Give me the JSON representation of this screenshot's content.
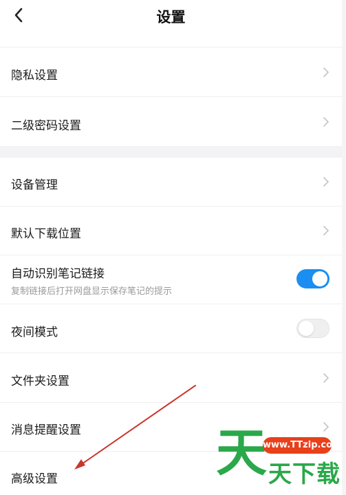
{
  "header": {
    "title": "设置",
    "back_icon": "chevron-left-icon"
  },
  "sections": [
    {
      "items": [
        {
          "label": "隐私设置",
          "control": "chevron"
        },
        {
          "label": "二级密码设置",
          "control": "chevron"
        }
      ]
    },
    {
      "items": [
        {
          "label": "设备管理",
          "control": "chevron"
        },
        {
          "label": "默认下载位置",
          "control": "chevron"
        },
        {
          "label": "自动识别笔记链接",
          "sublabel": "复制链接后打开网盘显示保存笔记的提示",
          "control": "toggle",
          "toggle_on": true
        },
        {
          "label": "夜间模式",
          "control": "toggle",
          "toggle_on": false
        },
        {
          "label": "文件夹设置",
          "control": "chevron"
        },
        {
          "label": "消息提醒设置",
          "control": "chevron"
        },
        {
          "label": "高级设置",
          "control": "chevron"
        }
      ]
    }
  ],
  "annotation": {
    "type": "red-arrow",
    "color": "#c8372d"
  },
  "watermark": {
    "logo_glyph": "天",
    "url": "www.TTzip.com",
    "text": "天下载"
  },
  "colors": {
    "toggle_on": "#1b8ef2",
    "toggle_off": "#efefef",
    "section_gap": "#f3f3f5",
    "watermark_green": "#2aa84a",
    "watermark_red": "#e8401b"
  }
}
